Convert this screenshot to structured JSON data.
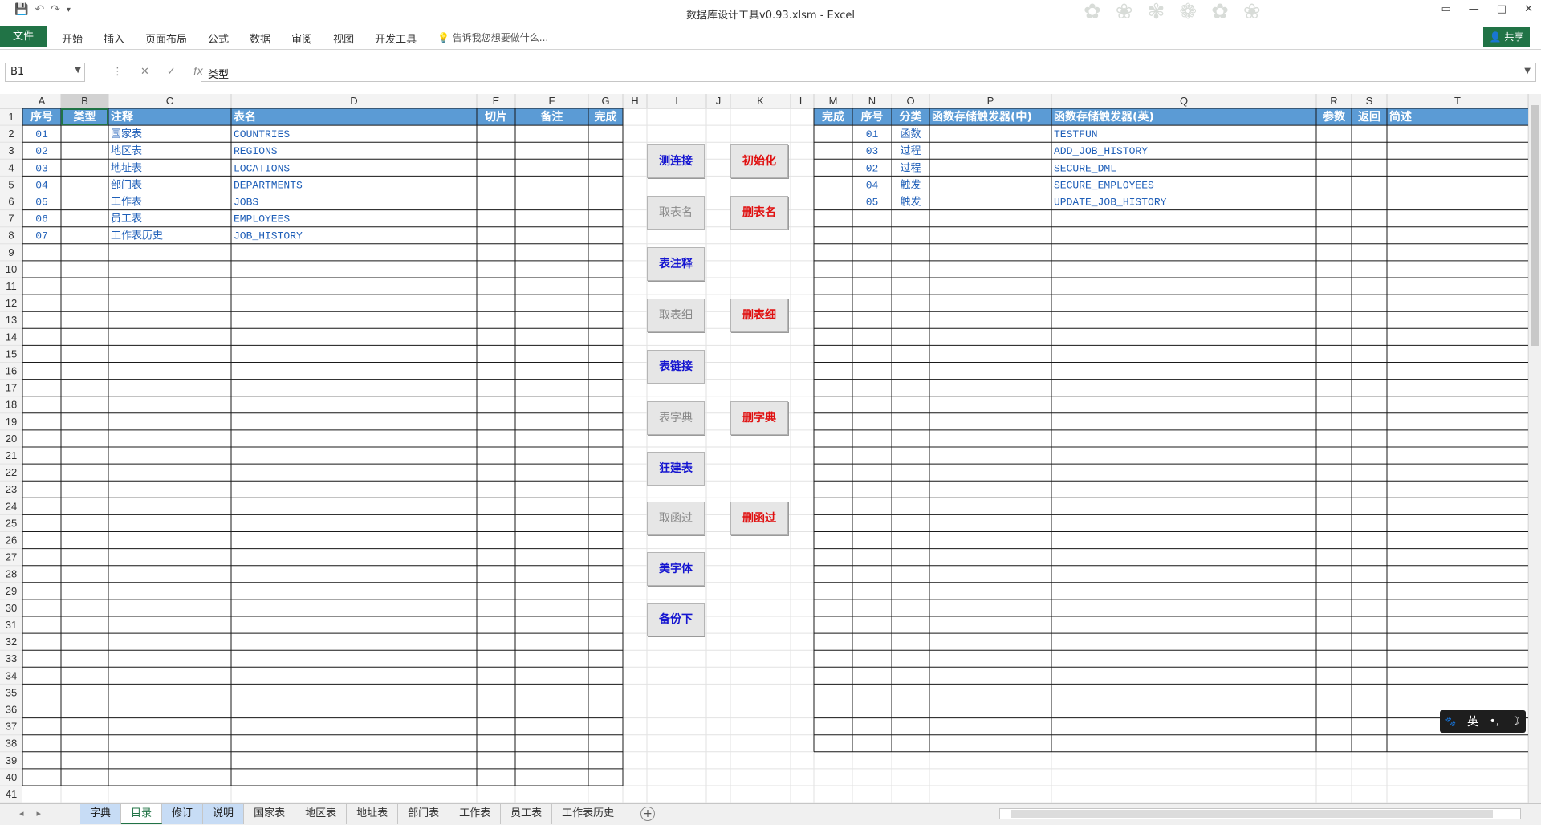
{
  "window": {
    "title": "数据库设计工具v0.93.xlsm - Excel",
    "save_icon": "save-icon",
    "undo_icon": "undo-icon",
    "redo_icon": "redo-icon",
    "minimize": "—",
    "maximize": "□",
    "close": "✕"
  },
  "ribbon": {
    "file": "文件",
    "tabs": [
      "开始",
      "插入",
      "页面布局",
      "公式",
      "数据",
      "审阅",
      "视图",
      "开发工具"
    ],
    "tell_me": "告诉我您想要做什么...",
    "share": "共享"
  },
  "formula_bar": {
    "name_box": "B1",
    "formula": "类型"
  },
  "columns": [
    "A",
    "B",
    "C",
    "D",
    "E",
    "F",
    "G",
    "H",
    "I",
    "J",
    "K",
    "L",
    "M",
    "N",
    "O",
    "P",
    "Q",
    "R",
    "S",
    "T"
  ],
  "header_row_left": [
    "序号",
    "类型",
    "注释",
    "表名",
    "切片",
    "备注",
    "完成"
  ],
  "header_row_right": [
    "完成",
    "序号",
    "分类",
    "函数存储触发器(中)",
    "函数存储触发器(英)",
    "参数",
    "返回",
    "简述"
  ],
  "left_table": [
    {
      "seq": "01",
      "comment": "国家表",
      "name": "COUNTRIES"
    },
    {
      "seq": "02",
      "comment": "地区表",
      "name": "REGIONS"
    },
    {
      "seq": "03",
      "comment": "地址表",
      "name": "LOCATIONS"
    },
    {
      "seq": "04",
      "comment": "部门表",
      "name": "DEPARTMENTS"
    },
    {
      "seq": "05",
      "comment": "工作表",
      "name": "JOBS"
    },
    {
      "seq": "06",
      "comment": "员工表",
      "name": "EMPLOYEES"
    },
    {
      "seq": "07",
      "comment": "工作表历史",
      "name": "JOB_HISTORY"
    }
  ],
  "right_table": [
    {
      "seq": "01",
      "kind": "函数",
      "name_en": "TESTFUN"
    },
    {
      "seq": "03",
      "kind": "过程",
      "name_en": "ADD_JOB_HISTORY"
    },
    {
      "seq": "02",
      "kind": "过程",
      "name_en": "SECURE_DML"
    },
    {
      "seq": "04",
      "kind": "触发",
      "name_en": "SECURE_EMPLOYEES"
    },
    {
      "seq": "05",
      "kind": "触发",
      "name_en": "UPDATE_JOB_HISTORY"
    }
  ],
  "row_numbers": [
    "1",
    "2",
    "3",
    "4",
    "5",
    "6",
    "7",
    "8",
    "9",
    "10",
    "11",
    "12",
    "13",
    "14",
    "15",
    "16",
    "17",
    "18",
    "19",
    "20",
    "21",
    "22",
    "23",
    "24",
    "25",
    "26",
    "27",
    "28",
    "29",
    "30",
    "31",
    "32",
    "33",
    "34",
    "35",
    "36",
    "37",
    "38",
    "39",
    "40",
    "41"
  ],
  "buttons": {
    "test_conn": "测连接",
    "init": "初始化",
    "get_table_names": "取表名",
    "del_table_names": "删表名",
    "table_comments": "表注释",
    "get_table_detail": "取表细",
    "del_table_detail": "删表细",
    "table_links": "表链接",
    "table_dict": "表字典",
    "del_dict": "删字典",
    "build_tables": "狂建表",
    "get_funcs": "取函过",
    "del_funcs": "删函过",
    "beautify_font": "美字体",
    "backup": "备份下"
  },
  "sheets": [
    {
      "label": "字典",
      "style": "blue"
    },
    {
      "label": "目录",
      "style": "active"
    },
    {
      "label": "修订",
      "style": "blue"
    },
    {
      "label": "说明",
      "style": "blue"
    },
    {
      "label": "国家表",
      "style": "normal"
    },
    {
      "label": "地区表",
      "style": "normal"
    },
    {
      "label": "地址表",
      "style": "normal"
    },
    {
      "label": "部门表",
      "style": "normal"
    },
    {
      "label": "工作表",
      "style": "normal"
    },
    {
      "label": "员工表",
      "style": "normal"
    },
    {
      "label": "工作表历史",
      "style": "normal"
    }
  ],
  "ime": {
    "lang": "英",
    "punct": "•,",
    "moon": "☽",
    "paw": "🐾"
  },
  "colors": {
    "header_blue": "#5b9bd5",
    "text_blue": "#1f5fb8",
    "excel_green": "#217346",
    "btn_red": "#e01010",
    "btn_blue": "#1515d0"
  }
}
